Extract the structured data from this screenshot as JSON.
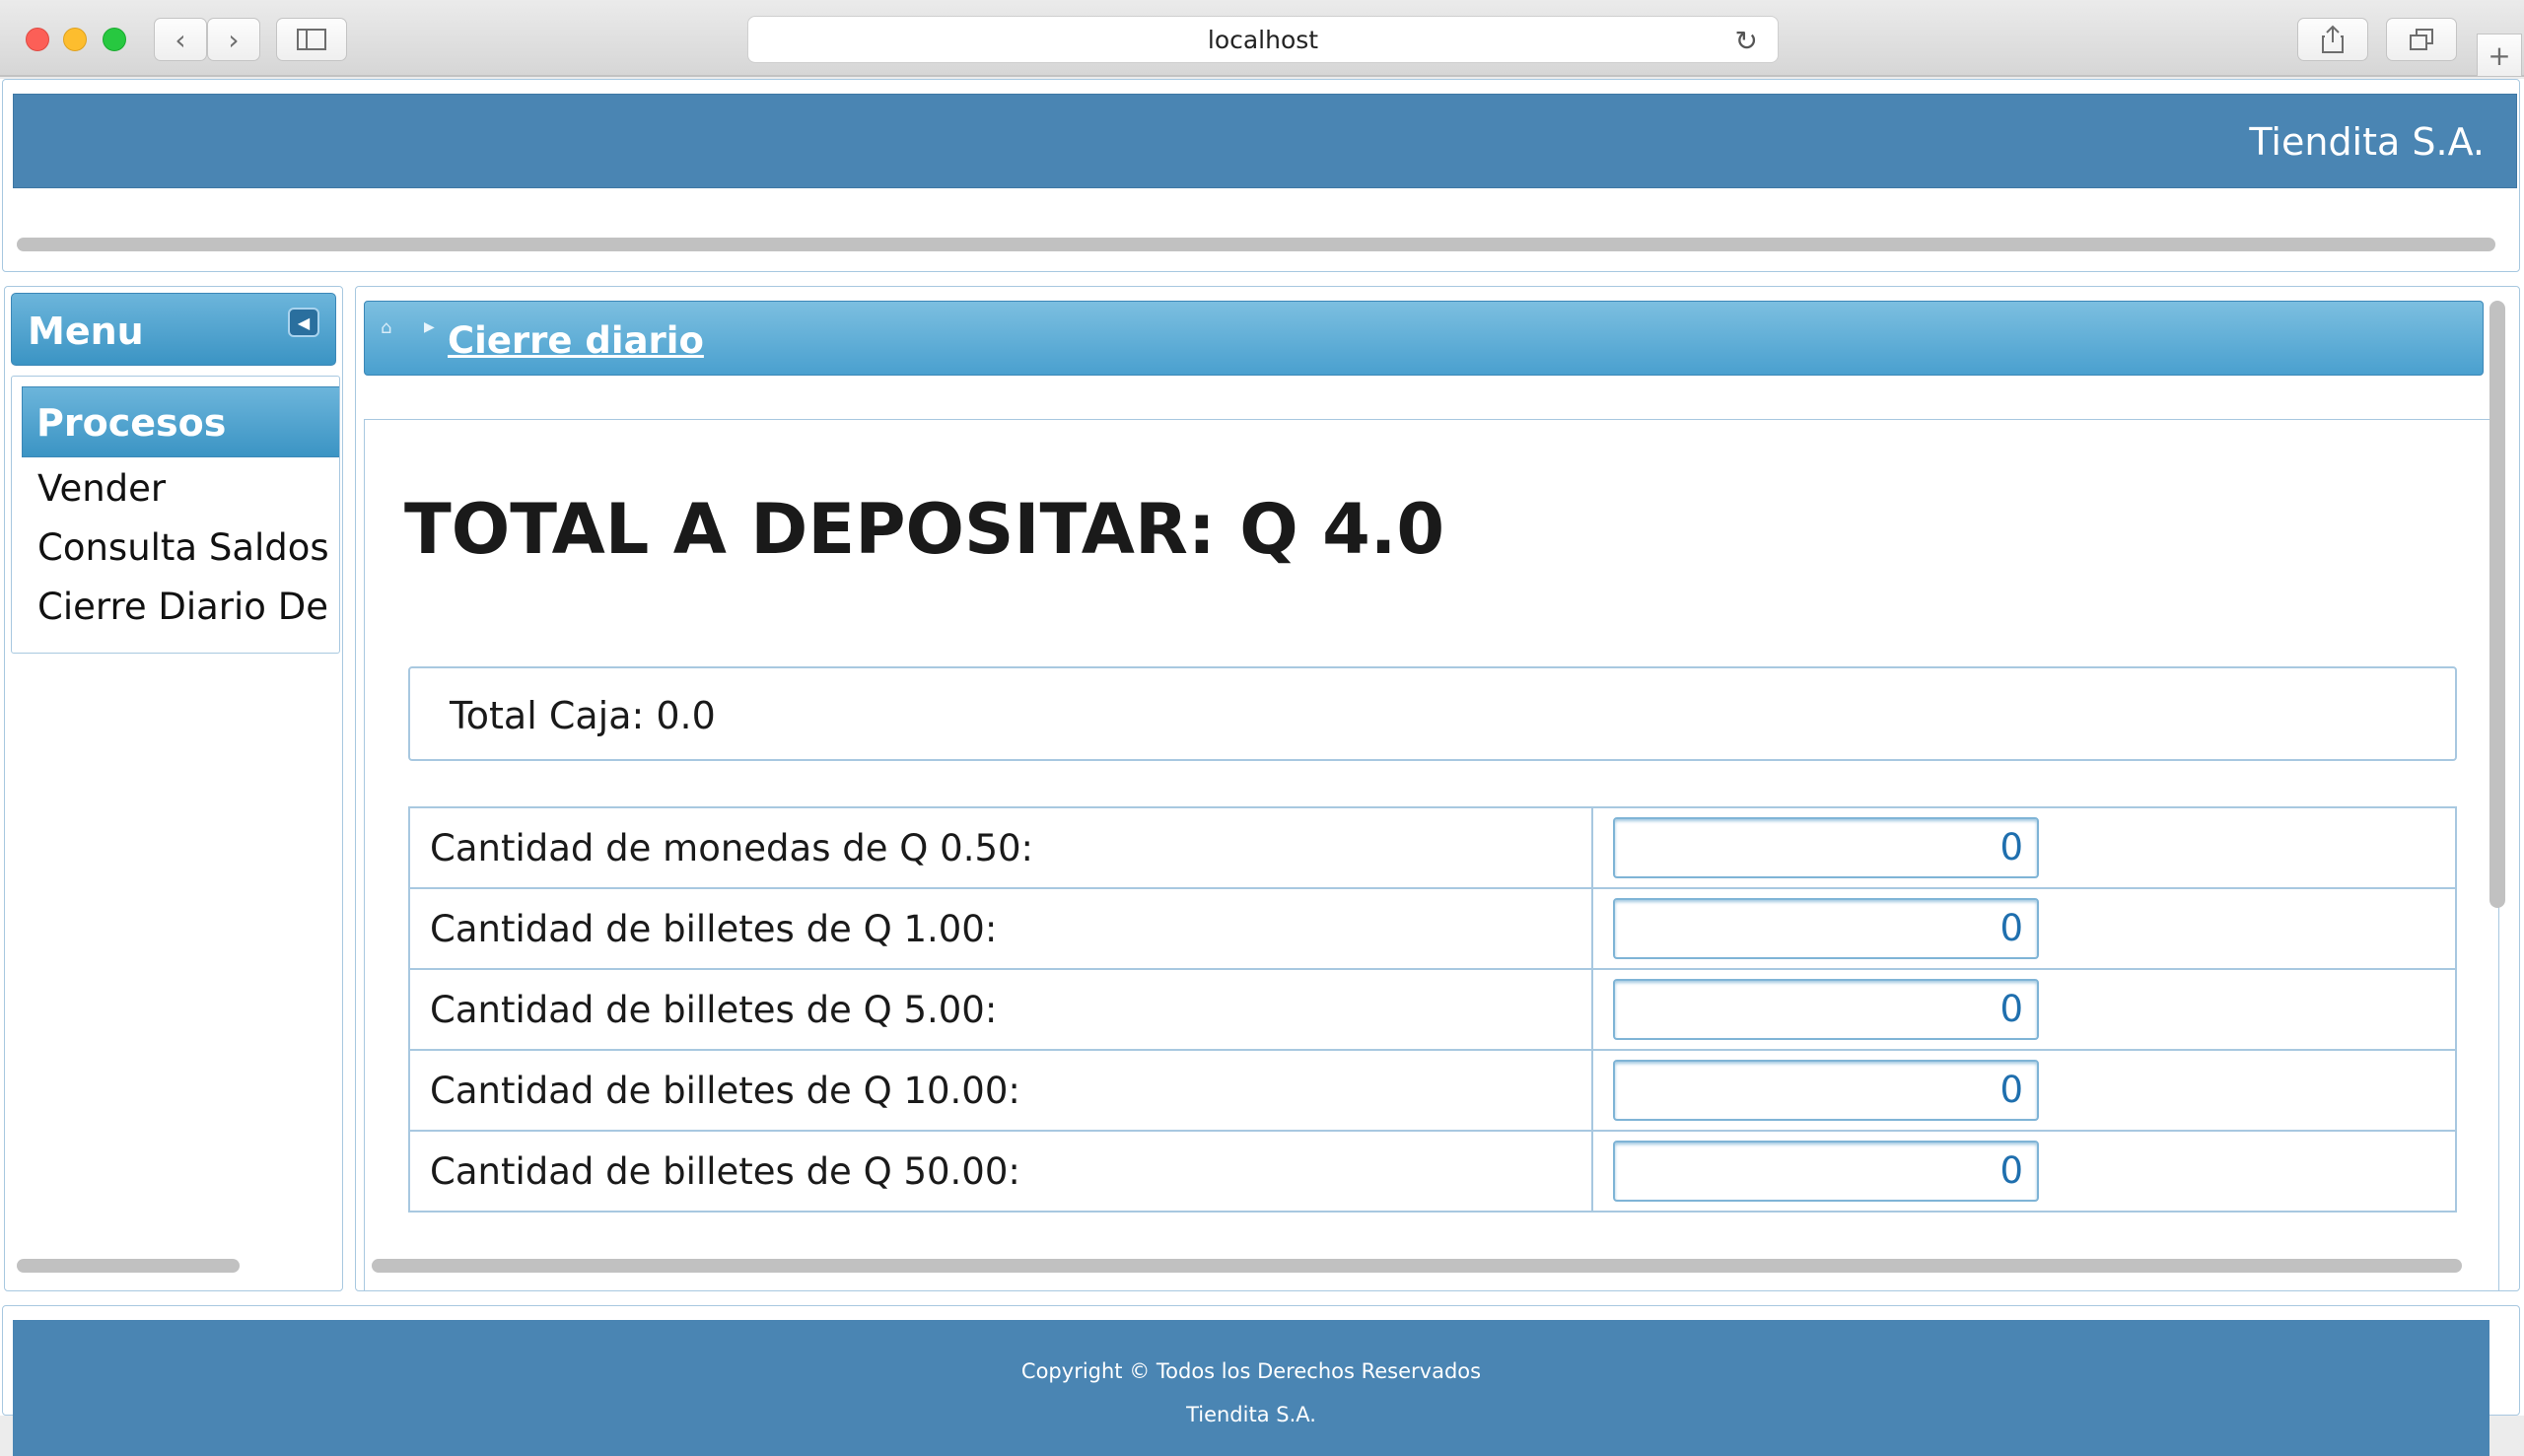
{
  "browser": {
    "url": "localhost",
    "back": "‹",
    "forward": "›",
    "reload": "↻",
    "new_tab": "+"
  },
  "header": {
    "brand": "Tiendita S.A."
  },
  "menu": {
    "title": "Menu",
    "section": "Procesos",
    "items": [
      {
        "label": "Vender"
      },
      {
        "label": "Consulta Saldos"
      },
      {
        "label": "Cierre Diario De Caja"
      }
    ]
  },
  "breadcrumb": {
    "current": "Cierre diario"
  },
  "main": {
    "total_title": "TOTAL A DEPOSITAR: Q 4.0",
    "total_caja": "Total Caja: 0.0",
    "rows": [
      {
        "label": "Cantidad de monedas de Q 0.50:",
        "value": "0"
      },
      {
        "label": "Cantidad de billetes de Q 1.00:",
        "value": "0"
      },
      {
        "label": "Cantidad de billetes de Q 5.00:",
        "value": "0"
      },
      {
        "label": "Cantidad de billetes de Q 10.00:",
        "value": "0"
      },
      {
        "label": "Cantidad de billetes de Q 50.00:",
        "value": "0"
      }
    ]
  },
  "footer": {
    "copyright": "Copyright © Todos los Derechos Reservados",
    "company": "Tiendita S.A."
  },
  "colors": {
    "header_blue": "#4a85b3",
    "panel_blue": "#3b94c4",
    "border_blue": "#a8c8e0"
  }
}
